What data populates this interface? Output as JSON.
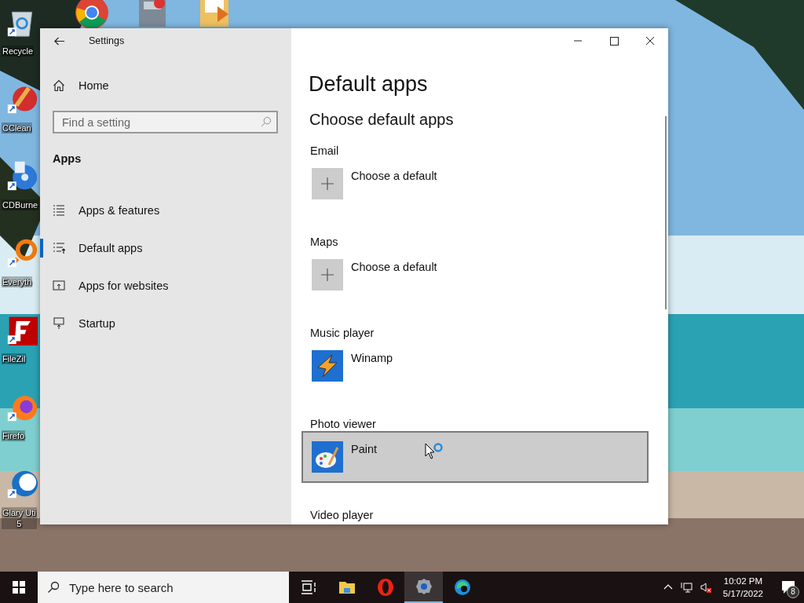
{
  "desktop_icons": [
    {
      "kind": "recycle",
      "label": "Recycle"
    },
    {
      "kind": "ccleaner",
      "label": "CClean"
    },
    {
      "kind": "cdburner",
      "label": "CDBurne"
    },
    {
      "kind": "everything",
      "label": "Everyth"
    },
    {
      "kind": "filezilla",
      "label": "FileZil"
    },
    {
      "kind": "firefox",
      "label": "Firefo"
    },
    {
      "kind": "glary",
      "label": "Glary Uti\n5"
    }
  ],
  "window": {
    "title": "Settings"
  },
  "nav": {
    "home": "Home",
    "search": {
      "placeholder": "Find a setting"
    },
    "section": "Apps",
    "items": [
      {
        "kind": "list",
        "label": "Apps & features",
        "selected": false
      },
      {
        "kind": "defaults",
        "label": "Default apps",
        "selected": true
      },
      {
        "kind": "websites",
        "label": "Apps for websites",
        "selected": false
      },
      {
        "kind": "startup",
        "label": "Startup",
        "selected": false
      }
    ]
  },
  "content": {
    "title": "Default apps",
    "subtitle": "Choose default apps",
    "categories": [
      {
        "label": "Email",
        "app": {
          "kind": "empty",
          "name": "Choose a default"
        },
        "selected": false
      },
      {
        "label": "Maps",
        "app": {
          "kind": "empty",
          "name": "Choose a default"
        },
        "selected": false
      },
      {
        "label": "Music player",
        "app": {
          "kind": "winamp",
          "name": "Winamp"
        },
        "selected": false
      },
      {
        "label": "Photo viewer",
        "app": {
          "kind": "paint",
          "name": "Paint"
        },
        "selected": true
      },
      {
        "label": "Video player"
      }
    ]
  },
  "taskbar": {
    "search": {
      "placeholder": "Type here to search"
    },
    "apps": [
      {
        "kind": "taskview",
        "selected": false
      },
      {
        "kind": "explorer",
        "selected": false
      },
      {
        "kind": "opera",
        "selected": false
      },
      {
        "kind": "settings",
        "selected": true
      },
      {
        "kind": "edge",
        "selected": false
      }
    ],
    "time": "10:02 PM",
    "date": "5/17/2022",
    "notifications": "8"
  }
}
